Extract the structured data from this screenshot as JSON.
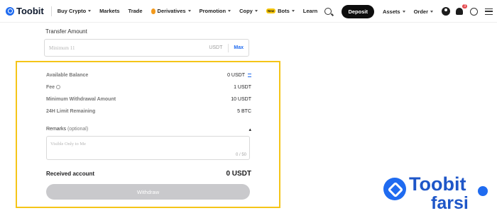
{
  "nav": {
    "logo": "Toobit",
    "items": [
      {
        "label": "Buy Crypto",
        "caret": true
      },
      {
        "label": "Markets",
        "caret": false
      },
      {
        "label": "Trade",
        "caret": false
      },
      {
        "label": "Derivatives",
        "caret": true
      },
      {
        "label": "Promotion",
        "caret": true
      },
      {
        "label": "Copy",
        "caret": true
      },
      {
        "label": "Bots",
        "caret": true
      },
      {
        "label": "Learn",
        "caret": false
      }
    ],
    "new_badge": "New",
    "deposit": "Deposit",
    "assets": "Assets",
    "order": "Order",
    "notification_count": "3"
  },
  "form": {
    "transfer_amount_label": "Transfer Amount",
    "amount_placeholder": "Minimum 11",
    "amount_unit": "USDT",
    "max": "Max",
    "available_balance_label": "Available Balance",
    "available_balance_value": "0 USDT",
    "fee_label": "Fee",
    "fee_value": "1 USDT",
    "min_withdrawal_label": "Minimum Withdrawal Amount",
    "min_withdrawal_value": "10 USDT",
    "limit_label": "24H Limit Remaining",
    "limit_value": "5 BTC",
    "remarks_label": "Remarks",
    "remarks_optional": "(optional)",
    "remarks_toggle": "▴",
    "remarks_placeholder": "Visible Only to Me",
    "remarks_counter": "0 / 50",
    "received_label": "Received account",
    "received_value": "0 USDT",
    "withdraw_button": "Withdraw"
  },
  "watermark": {
    "line1": "Toobit",
    "line2": "farsi"
  },
  "colors": {
    "accent_blue": "#1f6bf0",
    "highlight_border": "#f5c518",
    "disabled_button": "#c9c9cc"
  }
}
